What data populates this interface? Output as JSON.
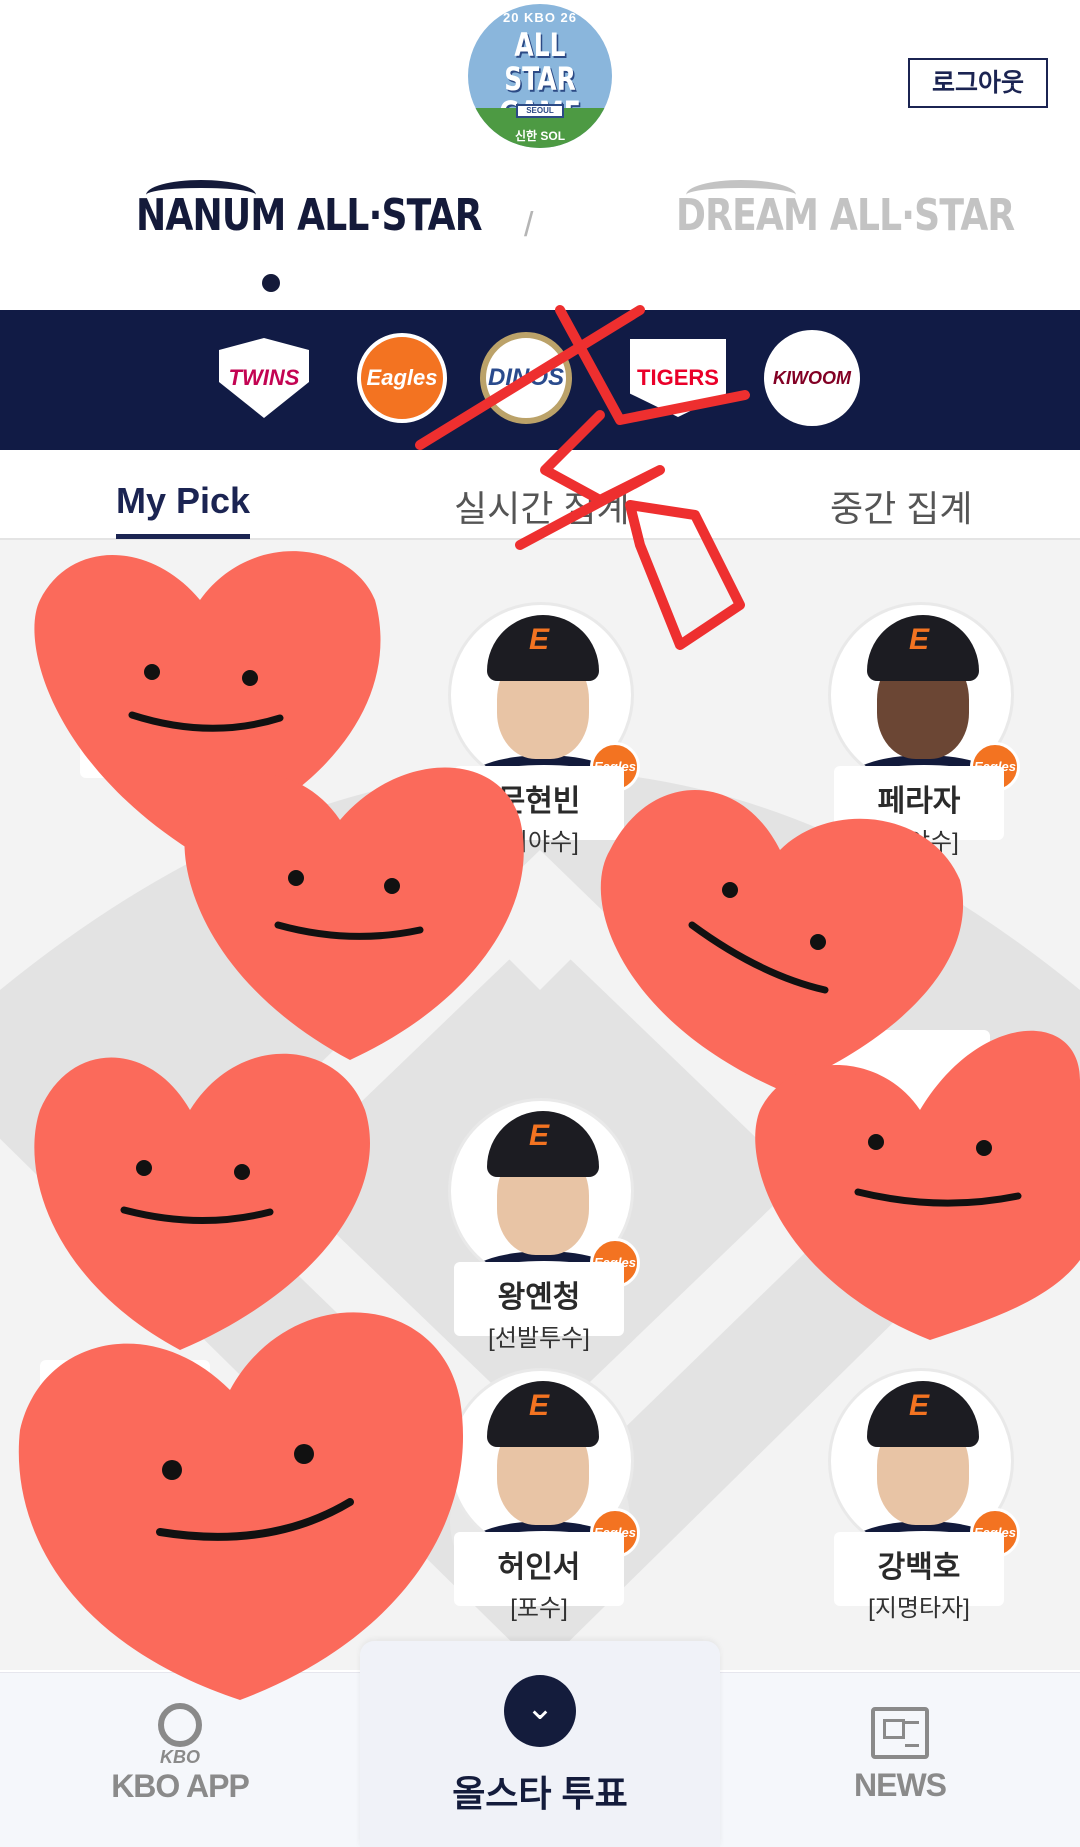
{
  "header": {
    "logo": {
      "top_text": "20 KBO 26",
      "main_text": "ALL STAR GAME",
      "stand_text": "SEOUL",
      "sponsor_text": "신한 SOL"
    },
    "logout_label": "로그아웃"
  },
  "allstar_tabs": {
    "nanum": "NANUM ALL·STAR",
    "separator": "/",
    "dream": "DREAM ALL·STAR"
  },
  "teams": [
    {
      "name": "TWINS",
      "icon": "lg-twins-logo"
    },
    {
      "name": "Eagles",
      "icon": "hanwha-eagles-logo"
    },
    {
      "name": "DINOS",
      "icon": "nc-dinos-logo"
    },
    {
      "name": "TIGERS",
      "icon": "kia-tigers-logo"
    },
    {
      "name": "KIWOOM",
      "icon": "kiwoom-heroes-logo"
    }
  ],
  "tabs": [
    {
      "label": "My Pick",
      "active": true
    },
    {
      "label": "실시간 집계",
      "active": false
    },
    {
      "label": "중간 집계",
      "active": false
    }
  ],
  "players": [
    {
      "name": "문현빈",
      "position": "[외야수]",
      "team_badge": "Eagles"
    },
    {
      "name": "페라자",
      "position": "[외야수]",
      "team_badge": "Eagles"
    },
    {
      "name": "왕옌청",
      "position": "[선발투수]",
      "team_badge": "Eagles"
    },
    {
      "name": "허인서",
      "position": "[포수]",
      "team_badge": "Eagles"
    },
    {
      "name": "강백호",
      "position": "[지명타자]",
      "team_badge": "Eagles"
    }
  ],
  "bottom_nav": {
    "kbo_app": {
      "mini": "KBO",
      "label": "KBO APP"
    },
    "vote": {
      "label": "올스타 투표",
      "icon": "chevron-down-icon"
    },
    "news": {
      "label": "NEWS",
      "icon": "newspaper-icon"
    }
  },
  "colors": {
    "navy": "#111b45",
    "accent": "#1b2452",
    "heart": "#fb6a5b",
    "scribble": "#ee2f2f",
    "eagles_orange": "#f37321"
  }
}
